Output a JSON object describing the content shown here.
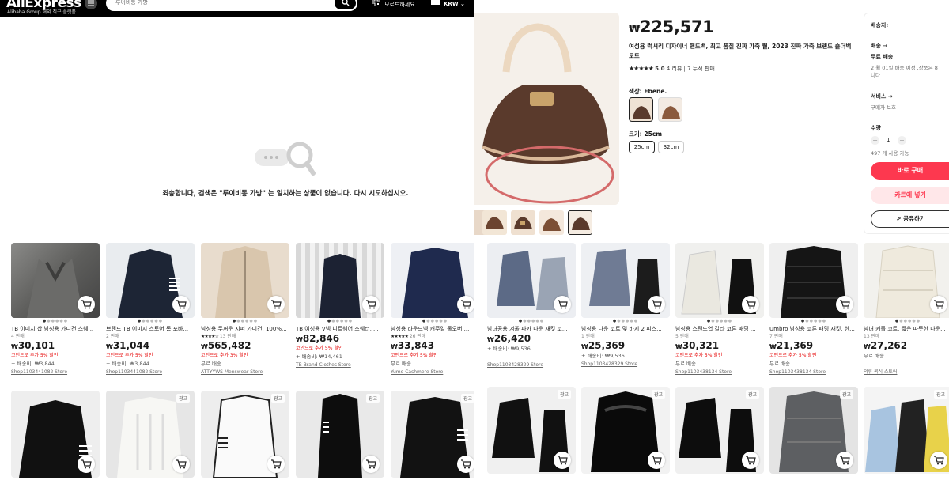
{
  "header": {
    "logo": "AliExpress",
    "logo_sub": "Alibaba Group 해외 직구 플랫폼",
    "search_value": "루이비통 가방",
    "download_label": "모로드하세요",
    "currency": "KRW"
  },
  "empty_state": {
    "message": "죄송합니다, 검색은 \"루이비통 가방\" 는 일치하는 상품이 없습니다. 다시 시도하십시오."
  },
  "left_products_row1": [
    {
      "title": "TB 이미지 샵 남성용 가디건 스웨...",
      "sub": "4 판매",
      "cur": "₩",
      "price": "30,101",
      "coupon": "코인으로 추가 5% 할인",
      "ship": "+ 배송비: ₩3,844",
      "store": "Shop1103441082 Store"
    },
    {
      "title": "브랜드 TB 이미지 스토어 톰 포바...",
      "sub": "2 판매",
      "cur": "₩",
      "price": "31,044",
      "coupon": "코인으로 추가 5% 할인",
      "ship": "+ 배송비: ₩3,844",
      "store": "Shop1103441082 Store"
    },
    {
      "title": "남성용 두꺼운 지퍼 가디건, 100%...",
      "sub": "13 판매",
      "cur": "₩",
      "price": "565,482",
      "coupon": "코인으로 추가 3% 할인",
      "ship": "무료 배송",
      "store": "ATTYYWS Menswear Store"
    },
    {
      "title": "TB 여성용 V넥 니트웨어 스웨터, ...",
      "sub": "",
      "cur": "₩",
      "price": "82,846",
      "coupon": "코인으로 추가 5% 할인",
      "ship": "+ 배송비: ₩14,461",
      "store": "TB Brand Clothes Store"
    },
    {
      "title": "남성용 라운드넥 캐주얼 풀오버 ...",
      "sub": "26 판매",
      "cur": "₩",
      "price": "33,843",
      "coupon": "코인으로 추가 5% 할인",
      "ship": "무료 배송",
      "store": "Yumo Cashmere Store"
    }
  ],
  "left_products_row2_ad": "광고",
  "product": {
    "cur": "₩",
    "price": "225,571",
    "title": "여성용 럭셔리 디자이너 핸드백, 최고 품질 진짜 가죽 웰, 2023 진짜 가죽 브랜드 숄더백 토트",
    "rating": "5.0",
    "reviews": "4 리뷰",
    "sold": "7 누적 판매",
    "color_label": "색상: Ebene.",
    "size_label": "크기: 25cm",
    "sizes": [
      "25cm",
      "32cm"
    ]
  },
  "buy_panel": {
    "ship_to": "배송지:",
    "shipping": "배송 →",
    "free_ship": "무료 배송",
    "delivery": "2 월 01일 배송 예정 ,상품은 8",
    "delivery2": "니다",
    "service": "서비스 →",
    "buyer_protect": "구매자 보호",
    "qty_label": "수량",
    "qty": "1",
    "available": "497 개 사용 가능",
    "buy_now": "바로 구매",
    "add_cart": "카트에 넣기",
    "share": "공유하기"
  },
  "right_products_row1": [
    {
      "title": "남녀공용 겨울 파카 다운 재킷 코...",
      "sub": "",
      "cur": "₩",
      "price": "26,420",
      "coupon": "",
      "ship": "+ 배송비: ₩9,536",
      "store": "Shop1103428329 Store"
    },
    {
      "title": "남성용 다운 코트 및 바지 2 피스...",
      "sub": "1 판매",
      "cur": "₩",
      "price": "25,369",
      "coupon": "",
      "ship": "+ 배송비: ₩9,536",
      "store": "Shop1103428329 Store"
    },
    {
      "title": "남성용 스탠드업 칼라 코튼 패딩 ...",
      "sub": "5 판매",
      "cur": "₩",
      "price": "30,321",
      "coupon": "코인으로 추가 5% 할인",
      "ship": "무료 배송",
      "store": "Shop1103438134 Store"
    },
    {
      "title": "Umbro 남성용 코튼 패딩 재킷, 한...",
      "sub": "7 판매",
      "cur": "₩",
      "price": "21,369",
      "coupon": "코인으로 추가 5% 할인",
      "ship": "무료 배송",
      "store": "Shop1103438134 Store"
    },
    {
      "title": "남녀 커플 코트, 짧은 따뜻한 다운...",
      "sub": "13 판매",
      "cur": "₩",
      "price": "27,262",
      "coupon": "",
      "ship": "무료 배송",
      "store": "의류 복식 스토어"
    }
  ],
  "colors": {
    "accent": "#fd384f",
    "coupon": "#e60000",
    "header_bg": "#000000"
  }
}
